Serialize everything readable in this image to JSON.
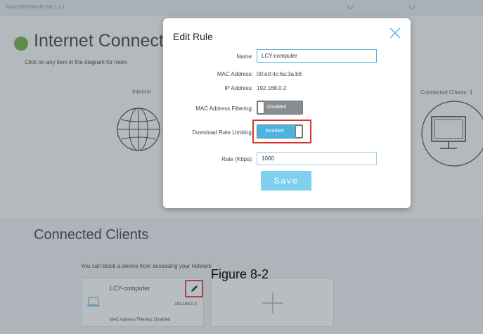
{
  "header": {
    "model": "RAX1500 HW:H1 FW:1.1.1"
  },
  "page": {
    "title": "Internet Connecti",
    "subtitle": "Click on any item in the diagram for more",
    "diagram": {
      "internet_label": "Internet",
      "clients_label": "Connected Clients: 1"
    }
  },
  "connected_clients": {
    "title": "Connected Clients",
    "subtitle": "You can block a device from accessing your network",
    "clients": [
      {
        "name": "LCY-computer",
        "ip": "192.168.0.2",
        "mac_filter_text": "MAC Address Filtering: Disabled"
      }
    ]
  },
  "figure_caption": "Figure 8-2",
  "modal": {
    "title": "Edit Rule",
    "fields": {
      "name_label": "Name:",
      "name_value": "LCY-computer",
      "mac_label": "MAC Address:",
      "mac_value": "00:e0:4c:6a:3a:b8",
      "ip_label": "IP Address:",
      "ip_value": "192.168.0.2",
      "mac_filter_label": "MAC Address Filtering:",
      "mac_filter_state": "Disabled",
      "download_limit_label": "Download Rate Limiting:",
      "download_limit_state": "Enabled",
      "rate_label": "Rate (Kbps):",
      "rate_value": "1000"
    },
    "save_label": "Save"
  },
  "colors": {
    "accent": "#4db4e2",
    "save_button": "#7fd0ef",
    "highlight": "#d9342b",
    "status_dot": "#5fa03a"
  },
  "icons": [
    "chevron-down-icon",
    "globe-icon",
    "monitor-icon",
    "close-icon",
    "computer-icon",
    "edit-pencil-icon",
    "plus-icon"
  ]
}
